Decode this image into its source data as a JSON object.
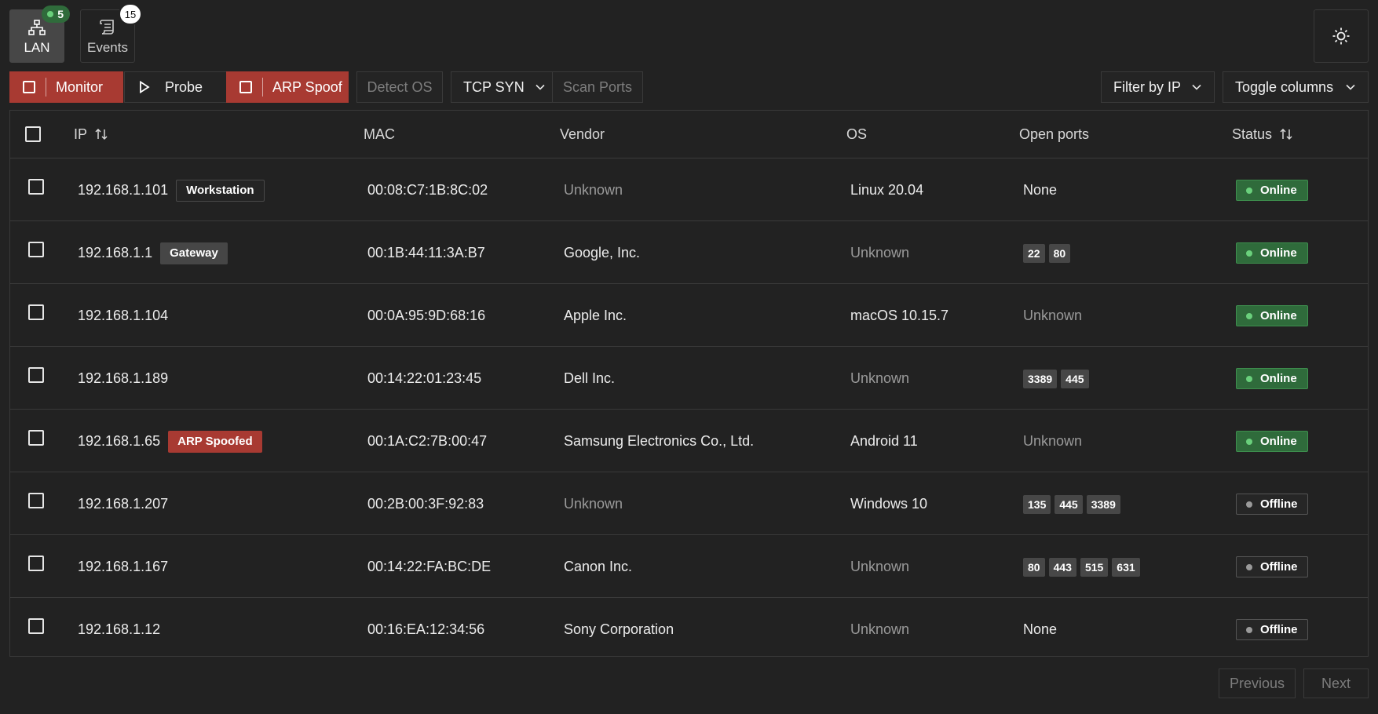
{
  "tabs": [
    {
      "label": "LAN",
      "badge": "5",
      "icon": "network-icon",
      "active": true
    },
    {
      "label": "Events",
      "badge": "15",
      "icon": "scroll-icon",
      "active": false
    }
  ],
  "theme_toggle": {
    "icon": "sun-icon"
  },
  "toolbar": {
    "monitor": "Monitor",
    "probe": "Probe",
    "arp_spoof": "ARP Spoof",
    "detect_os": "Detect OS",
    "scan_mode": "TCP SYN",
    "scan_ports": "Scan Ports",
    "filter": "Filter by IP",
    "toggle_columns": "Toggle columns"
  },
  "columns": {
    "ip": "IP",
    "mac": "MAC",
    "vendor": "Vendor",
    "os": "OS",
    "ports": "Open ports",
    "status": "Status"
  },
  "rows": [
    {
      "ip": "192.168.1.101",
      "tag": "Workstation",
      "mac": "00:08:C7:1B:8C:02",
      "vendor": "Unknown",
      "os": "Linux 20.04",
      "ports_text": "None",
      "ports": [],
      "status": "Online"
    },
    {
      "ip": "192.168.1.1",
      "tag": "Gateway",
      "mac": "00:1B:44:11:3A:B7",
      "vendor": "Google, Inc.",
      "os": "Unknown",
      "ports_text": "",
      "ports": [
        "22",
        "80"
      ],
      "status": "Online"
    },
    {
      "ip": "192.168.1.104",
      "tag": "",
      "mac": "00:0A:95:9D:68:16",
      "vendor": "Apple Inc.",
      "os": "macOS 10.15.7",
      "ports_text": "Unknown",
      "ports": [],
      "status": "Online"
    },
    {
      "ip": "192.168.1.189",
      "tag": "",
      "mac": "00:14:22:01:23:45",
      "vendor": "Dell Inc.",
      "os": "Unknown",
      "ports_text": "",
      "ports": [
        "3389",
        "445"
      ],
      "status": "Online"
    },
    {
      "ip": "192.168.1.65",
      "tag": "ARP Spoofed",
      "mac": "00:1A:C2:7B:00:47",
      "vendor": "Samsung Electronics Co., Ltd.",
      "os": "Android 11",
      "ports_text": "Unknown",
      "ports": [],
      "status": "Online"
    },
    {
      "ip": "192.168.1.207",
      "tag": "",
      "mac": "00:2B:00:3F:92:83",
      "vendor": "Unknown",
      "os": "Windows 10",
      "ports_text": "",
      "ports": [
        "135",
        "445",
        "3389"
      ],
      "status": "Offline"
    },
    {
      "ip": "192.168.1.167",
      "tag": "",
      "mac": "00:14:22:FA:BC:DE",
      "vendor": "Canon Inc.",
      "os": "Unknown",
      "ports_text": "",
      "ports": [
        "80",
        "443",
        "515",
        "631"
      ],
      "status": "Offline"
    },
    {
      "ip": "192.168.1.12",
      "tag": "",
      "mac": "00:16:EA:12:34:56",
      "vendor": "Sony Corporation",
      "os": "Unknown",
      "ports_text": "None",
      "ports": [],
      "status": "Offline"
    }
  ],
  "pagination": {
    "previous": "Previous",
    "next": "Next"
  },
  "colors": {
    "accent_red": "#a83a32",
    "online_green": "#2f6b3b",
    "background": "#222222"
  }
}
